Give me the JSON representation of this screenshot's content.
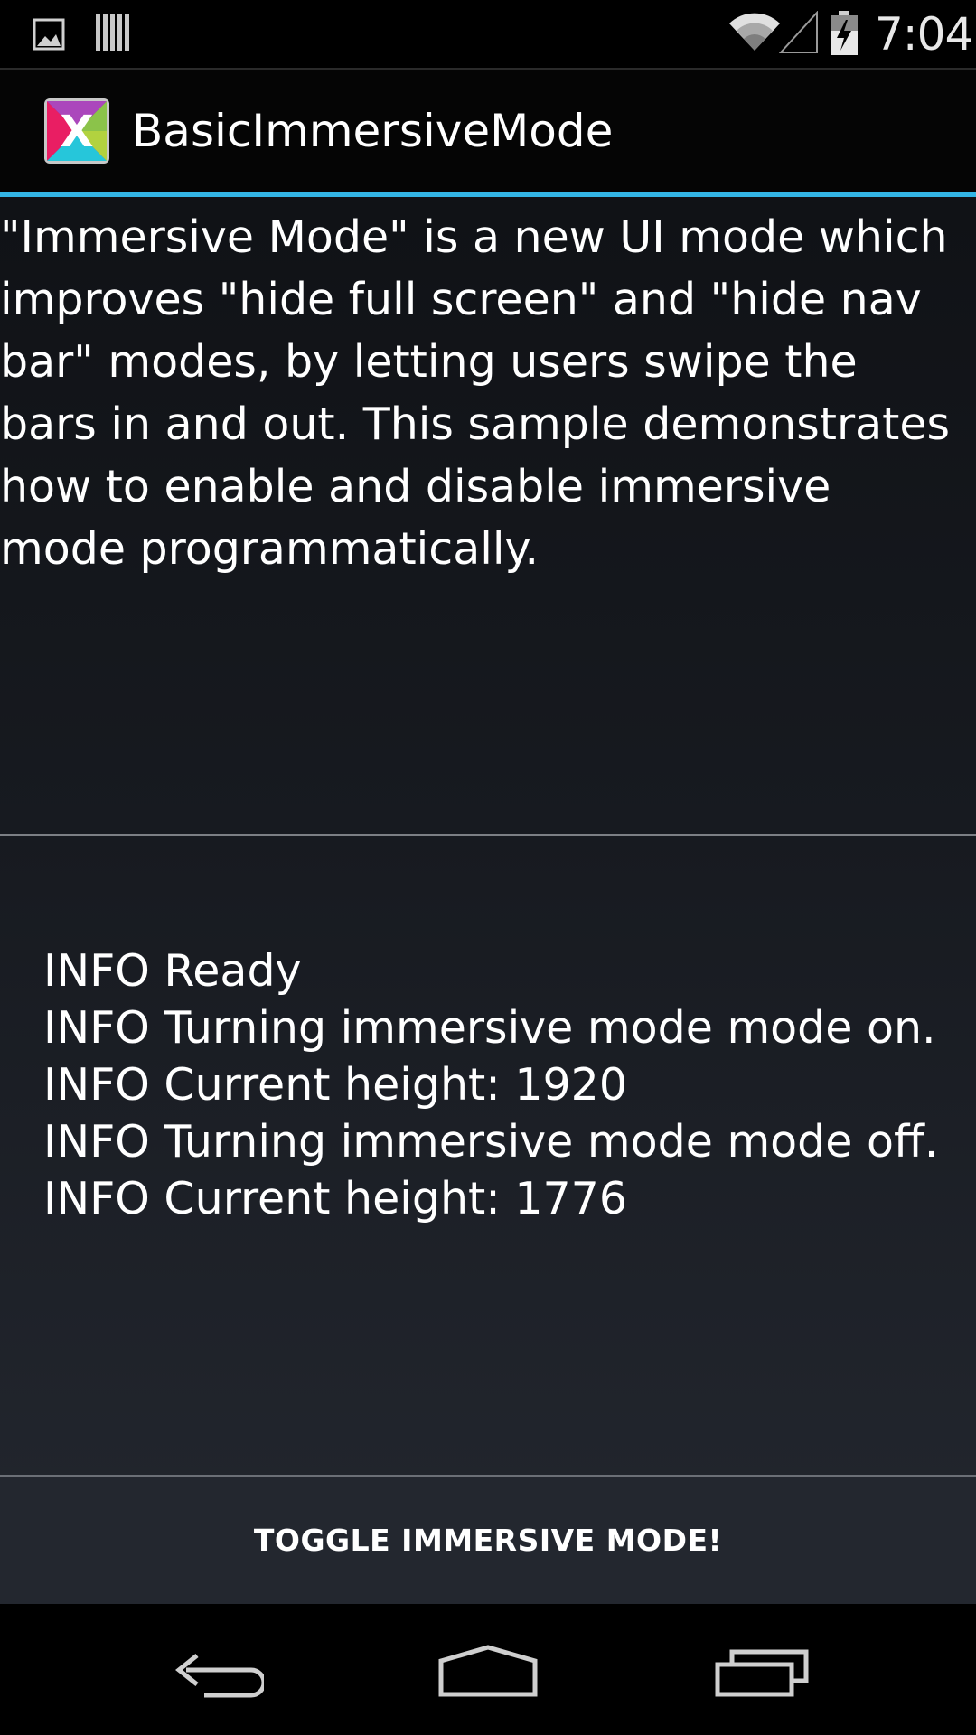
{
  "status_bar": {
    "icons": [
      "gallery-notification-icon",
      "barcode-notification-icon",
      "wifi-icon",
      "cell-signal-icon",
      "battery-charging-icon"
    ],
    "time": "7:04"
  },
  "action_bar": {
    "title": "BasicImmersiveMode",
    "icon": "app-logo-icon",
    "accent_color": "#33b5e5"
  },
  "intro": {
    "text": "\"Immersive Mode\" is a new UI mode which improves \"hide full screen\" and \"hide nav bar\" modes, by letting users swipe the bars in and out. This sample demonstrates how to enable and disable immersive mode programmatically."
  },
  "log": {
    "entries": [
      "INFO Ready",
      "INFO Turning immersive mode mode on.",
      "INFO Current height: 1920",
      "INFO Turning immersive mode mode off.",
      "INFO Current height: 1776"
    ]
  },
  "toggle_button": {
    "label": "TOGGLE IMMERSIVE MODE!"
  },
  "nav_bar": {
    "icons": [
      "back-icon",
      "home-icon",
      "recents-icon"
    ]
  }
}
